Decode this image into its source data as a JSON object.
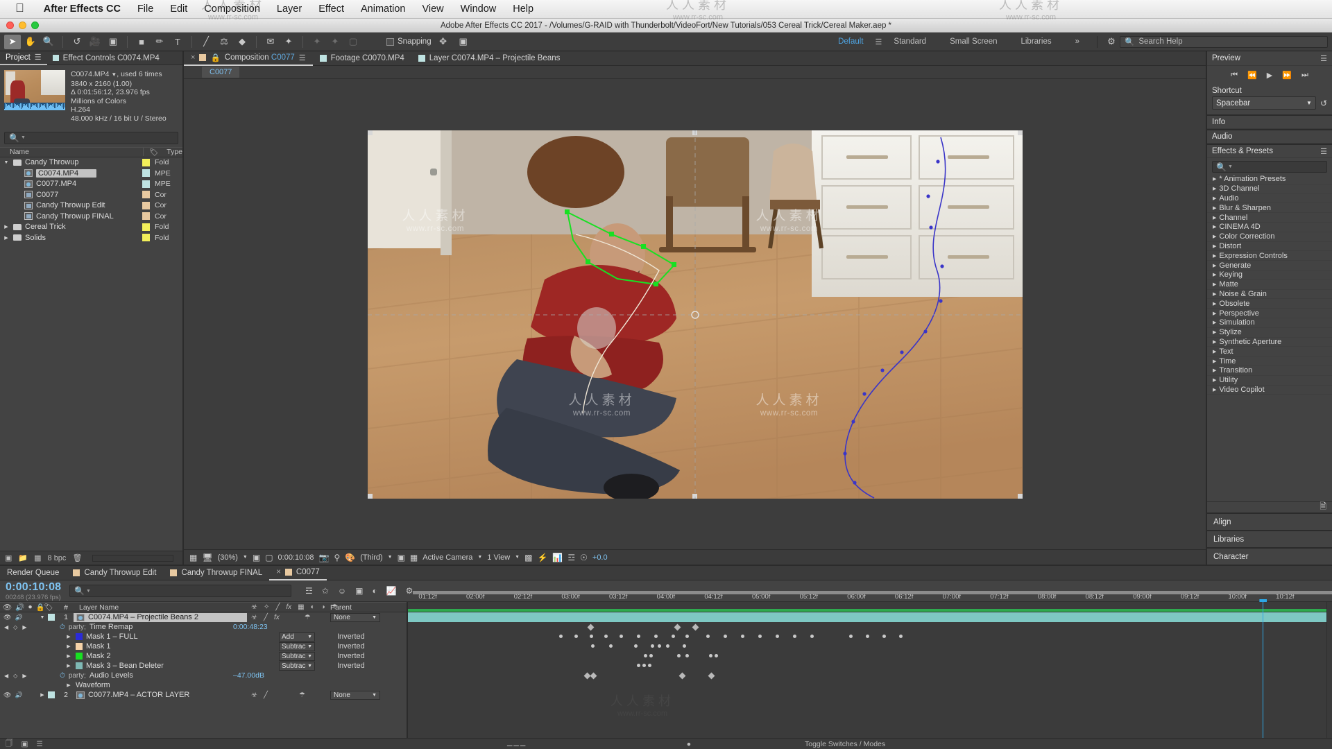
{
  "os_menu": {
    "apple": "",
    "items": [
      "After Effects CC",
      "File",
      "Edit",
      "Composition",
      "Layer",
      "Effect",
      "Animation",
      "View",
      "Window",
      "Help"
    ]
  },
  "window": {
    "title": "Adobe After Effects CC 2017 - /Volumes/G-RAID with Thunderbolt/VideoFort/New Tutorials/053 Cereal Trick/Cereal Maker.aep *"
  },
  "toolbar": {
    "snapping_label": "Snapping",
    "workspaces": [
      "Default",
      "Standard",
      "Small Screen",
      "Libraries"
    ],
    "workspace_active": "Default",
    "overflow": "»",
    "search_help_placeholder": "Search Help"
  },
  "project": {
    "tabs": [
      {
        "label": "Project",
        "selected": true
      },
      {
        "label": "Effect Controls C0074.MP4",
        "selected": false
      }
    ],
    "info": {
      "name": "C0074.MP4",
      "used": ", used 6 times",
      "dimensions": "3840 x 2160 (1.00)",
      "duration": "Δ 0:01:56:12, 23.976 fps",
      "colors": "Millions of Colors",
      "codec": "H.264",
      "audio": "48.000 kHz / 16 bit U / Stereo"
    },
    "search_placeholder": "",
    "columns": [
      "Name",
      "",
      "Type"
    ],
    "items": [
      {
        "label": "Candy Throwup",
        "type": "Fold",
        "icon": "folder",
        "swatch": "#f2ef5a",
        "depth": 0,
        "expanded": true,
        "selected": false
      },
      {
        "label": "C0074.MP4",
        "type": "MPE",
        "icon": "video",
        "swatch": "#bfe3e2",
        "depth": 1,
        "expanded": false,
        "selected": true
      },
      {
        "label": "C0077.MP4",
        "type": "MPE",
        "icon": "video",
        "swatch": "#bfe3e2",
        "depth": 1,
        "expanded": false,
        "selected": false
      },
      {
        "label": "C0077",
        "type": "Cor",
        "icon": "comp",
        "swatch": "#e8c9a0",
        "depth": 1,
        "expanded": false,
        "selected": false
      },
      {
        "label": "Candy Throwup Edit",
        "type": "Cor",
        "icon": "comp",
        "swatch": "#e8c9a0",
        "depth": 1,
        "expanded": false,
        "selected": false
      },
      {
        "label": "Candy Throwup FINAL",
        "type": "Cor",
        "icon": "comp",
        "swatch": "#e8c9a0",
        "depth": 1,
        "expanded": false,
        "selected": false
      },
      {
        "label": "Cereal Trick",
        "type": "Fold",
        "icon": "folder",
        "swatch": "#f2ef5a",
        "depth": 0,
        "expanded": false,
        "selected": false
      },
      {
        "label": "Solids",
        "type": "Fold",
        "icon": "folder",
        "swatch": "#f2ef5a",
        "depth": 0,
        "expanded": false,
        "selected": false
      }
    ],
    "bpc": "8 bpc"
  },
  "composition": {
    "tabs": [
      {
        "label": "Composition C0077",
        "highlight": "C0077",
        "selected": true,
        "swatch": "#e8c9a0",
        "closable": true,
        "locked": true
      },
      {
        "label": "Footage C0070.MP4",
        "selected": false,
        "swatch": "#bfe3e2",
        "closable": false,
        "locked": false
      },
      {
        "label": "Layer C0074.MP4 – Projectile Beans",
        "selected": false,
        "swatch": "#bfe3e2",
        "closable": false,
        "locked": false
      }
    ],
    "breadcrumb": "C0077",
    "bottom_bar": {
      "zoom": "(30%)",
      "timecode": "0:00:10:08",
      "resolution": "(Third)",
      "camera": "Active Camera",
      "views": "1 View",
      "exposure": "+0.0"
    }
  },
  "right": {
    "preview": {
      "title": "Preview",
      "shortcut_label": "Shortcut",
      "shortcut_value": "Spacebar"
    },
    "info_title": "Info",
    "audio_title": "Audio",
    "effects": {
      "title": "Effects & Presets",
      "search_placeholder": "",
      "categories": [
        "* Animation Presets",
        "3D Channel",
        "Audio",
        "Blur & Sharpen",
        "Channel",
        "CINEMA 4D",
        "Color Correction",
        "Distort",
        "Expression Controls",
        "Generate",
        "Keying",
        "Matte",
        "Noise & Grain",
        "Obsolete",
        "Perspective",
        "Simulation",
        "Stylize",
        "Synthetic Aperture",
        "Text",
        "Time",
        "Transition",
        "Utility",
        "Video Copilot"
      ]
    },
    "collapsed_panels": [
      "Align",
      "Libraries",
      "Character"
    ]
  },
  "timeline": {
    "tabs": [
      {
        "label": "Render Queue",
        "selected": false,
        "swatch": null,
        "closable": false
      },
      {
        "label": "Candy Throwup Edit",
        "selected": false,
        "swatch": "#e8c9a0",
        "closable": false
      },
      {
        "label": "Candy Throwup FINAL",
        "selected": false,
        "swatch": "#e8c9a0",
        "closable": false
      },
      {
        "label": "C0077",
        "selected": true,
        "swatch": "#e8c9a0",
        "closable": true
      }
    ],
    "current_time": "0:00:10:08",
    "current_frame": "00248 (23.976 fps)",
    "search_placeholder": "",
    "columns": {
      "num": "#",
      "layer_name": "Layer Name",
      "parent": "Parent"
    },
    "bottom_label": "Toggle Switches / Modes",
    "rows": [
      {
        "kind": "layer",
        "num": "1",
        "label": "C0074.MP4 – Projectile Beans 2",
        "selected": true,
        "swatch": "#bfe3e2",
        "expanded": true,
        "parent": "None",
        "video": true,
        "audio": true
      },
      {
        "kind": "prop",
        "label": "Time Remap",
        "value": "0:00:48:23",
        "indent": 2,
        "stopwatch": true,
        "graph": true,
        "kfnav": true
      },
      {
        "kind": "mask",
        "label": "Mask 1 – FULL",
        "mode": "Add",
        "inverted": "Inverted",
        "color": "#2b2bd8",
        "indent": 3
      },
      {
        "kind": "mask",
        "label": "Mask 1",
        "mode": "Subtrac",
        "inverted": "Inverted",
        "color": "#f5d2a8",
        "indent": 3
      },
      {
        "kind": "mask",
        "label": "Mask 2",
        "mode": "Subtrac",
        "inverted": "Inverted",
        "color": "#18e022",
        "indent": 3
      },
      {
        "kind": "mask",
        "label": "Mask 3 – Bean Deleter",
        "mode": "Subtrac",
        "inverted": "Inverted",
        "color": "#7fb9b5",
        "indent": 3
      },
      {
        "kind": "prop",
        "label": "Audio Levels",
        "value": "–47.00dB",
        "indent": 2,
        "stopwatch": true,
        "graph": true,
        "kfnav": true
      },
      {
        "kind": "group",
        "label": "Waveform",
        "indent": 3
      },
      {
        "kind": "layer",
        "num": "2",
        "label": "C0077.MP4 – ACTOR LAYER",
        "selected": false,
        "swatch": "#bfe3e2",
        "expanded": false,
        "parent": "None",
        "video": true,
        "audio": true
      }
    ],
    "ruler_ticks": [
      "01:12f",
      "02:00f",
      "02:12f",
      "03:00f",
      "03:12f",
      "04:00f",
      "04:12f",
      "05:00f",
      "05:12f",
      "06:00f",
      "06:12f",
      "07:00f",
      "07:12f",
      "08:00f",
      "08:12f",
      "09:00f",
      "09:12f",
      "10:00f",
      "10:12f"
    ]
  },
  "watermark": {
    "cn": "人人素材",
    "en": "www.rr-sc.com"
  },
  "colors": {
    "accent_blue": "#2ea8e6",
    "panel_bg": "#434343",
    "panel_dark": "#3b3b3b",
    "text": "#d4d4d4",
    "selection": "#c3c3c3"
  }
}
